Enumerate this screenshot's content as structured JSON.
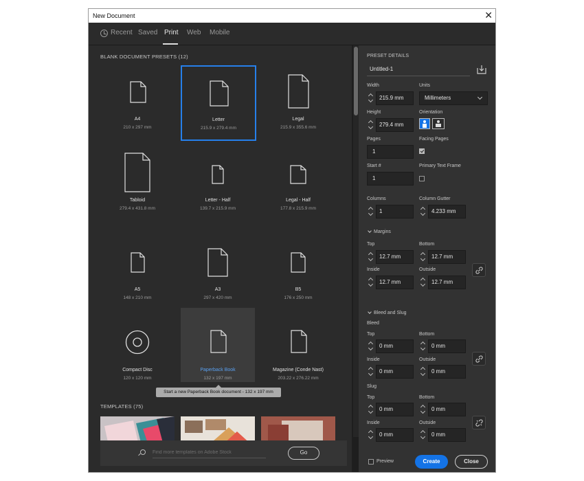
{
  "window": {
    "title": "New Document"
  },
  "tabs": [
    "Recent",
    "Saved",
    "Print",
    "Web",
    "Mobile"
  ],
  "presets_section": {
    "title": "BLANK DOCUMENT PRESETS",
    "count": "(12)"
  },
  "presets": [
    {
      "name": "A4",
      "dims": "210 x 297 mm"
    },
    {
      "name": "Letter",
      "dims": "215.9 x 279.4 mm"
    },
    {
      "name": "Legal",
      "dims": "215.9 x 355.6 mm"
    },
    {
      "name": "Tabloid",
      "dims": "279.4 x 431.8 mm"
    },
    {
      "name": "Letter - Half",
      "dims": "139.7 x 215.9 mm"
    },
    {
      "name": "Legal - Half",
      "dims": "177.8 x 215.9 mm"
    },
    {
      "name": "A5",
      "dims": "148 x 210 mm"
    },
    {
      "name": "A3",
      "dims": "297 x 420 mm"
    },
    {
      "name": "B5",
      "dims": "176 x 250 mm"
    },
    {
      "name": "Compact Disc",
      "dims": "120 x 120 mm"
    },
    {
      "name": "Paperback Book",
      "dims": "132 x 197 mm"
    },
    {
      "name": "Magazine (Conde Nast)",
      "dims": "203.22 x 276.22 mm"
    }
  ],
  "tooltip": "Start a new Paperback Book document - 132 x 197 mm",
  "templates_section": {
    "title": "TEMPLATES",
    "count": "(75)"
  },
  "search": {
    "placeholder": "Find more templates on Adobe Stock",
    "go_label": "Go"
  },
  "details": {
    "title": "PRESET DETAILS",
    "name": "Untitled-1",
    "width_label": "Width",
    "width": "215.9 mm",
    "units_label": "Units",
    "units": "Millimeters",
    "height_label": "Height",
    "height": "279.4 mm",
    "orientation_label": "Orientation",
    "pages_label": "Pages",
    "pages": "1",
    "facing_label": "Facing Pages",
    "facing_pages": true,
    "start_label": "Start #",
    "start": "1",
    "primary_label": "Primary Text Frame",
    "primary_text_frame": false,
    "columns_label": "Columns",
    "columns": "1",
    "gutter_label": "Column Gutter",
    "gutter": "4.233 mm",
    "margins_label": "Margins",
    "top_label": "Top",
    "bottom_label": "Bottom",
    "inside_label": "Inside",
    "outside_label": "Outside",
    "margins": {
      "top": "12.7 mm",
      "bottom": "12.7 mm",
      "inside": "12.7 mm",
      "outside": "12.7 mm"
    },
    "bleed_slug_label": "Bleed and Slug",
    "bleed_label": "Bleed",
    "bleed": {
      "top": "0 mm",
      "bottom": "0 mm",
      "inside": "0 mm",
      "outside": "0 mm"
    },
    "slug_label": "Slug",
    "slug": {
      "top": "0 mm",
      "bottom": "0 mm",
      "inside": "0 mm",
      "outside": "0 mm"
    },
    "preview_label": "Preview",
    "preview": false,
    "create_label": "Create",
    "close_label": "Close"
  },
  "colors": {
    "accent": "#1473e6",
    "selection": "#2680eb",
    "panel": "#323232",
    "background": "#2b2b2b"
  }
}
